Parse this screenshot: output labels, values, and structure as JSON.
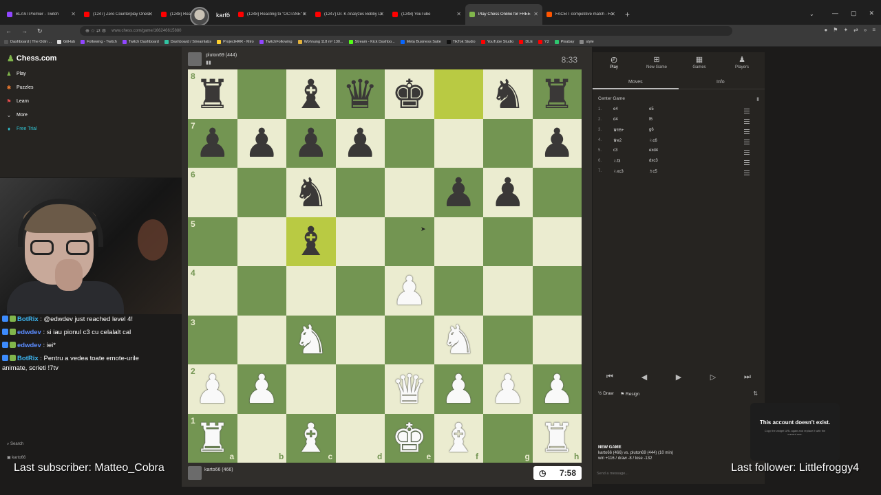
{
  "browser": {
    "tabs": [
      {
        "label": "BLASTPremier - Twitch",
        "color": "#9146ff",
        "active": false
      },
      {
        "label": "(1247) Zero Counterplay Onesi",
        "color": "#ff0000",
        "active": false
      },
      {
        "label": "(1248) React",
        "color": "#ff0000",
        "active": false
      },
      {
        "label": "(1248) Reacting to \"OCTANE\" b",
        "color": "#ff0000",
        "active": false
      },
      {
        "label": "(1247) Dr. K Analyzes Bobby Le",
        "color": "#ff0000",
        "active": false
      },
      {
        "label": "(1248) YouTube",
        "color": "#ff0000",
        "active": false
      },
      {
        "label": "Play Chess Online for FREE",
        "color": "#81b64c",
        "active": true
      },
      {
        "label": "FACEIT competitive match - FA",
        "color": "#ff5500",
        "active": false
      }
    ],
    "new_tab": "+",
    "profile_name": "karto",
    "url": "www.chess.com/game/166246615880",
    "bookmarks": [
      {
        "label": "Dashboard | The Odin ...",
        "color": "#555"
      },
      {
        "label": "GitHub",
        "color": "#ddd"
      },
      {
        "label": "Following - Twitch",
        "color": "#9146ff"
      },
      {
        "label": "Twitch Dashboard",
        "color": "#9146ff"
      },
      {
        "label": "Dashboard / Streamlabs",
        "color": "#31c3a2"
      },
      {
        "label": "ProjectHRR - Miro",
        "color": "#ffd02f"
      },
      {
        "label": "TwitchFollowing",
        "color": "#9146ff"
      },
      {
        "label": "Wohnung 118 m² 130...",
        "color": "#e3b23c"
      },
      {
        "label": "Stream - Kick Dashbo...",
        "color": "#53fc18"
      },
      {
        "label": "Meta Business Suite",
        "color": "#0866ff"
      },
      {
        "label": "TikTok Studio",
        "color": "#111"
      },
      {
        "label": "YouTube Studio",
        "color": "#ff0000"
      },
      {
        "label": "DLE",
        "color": "#ff0000"
      },
      {
        "label": "Y2",
        "color": "#ff0000"
      },
      {
        "label": "Pixabay",
        "color": "#2ec66e"
      },
      {
        "label": "style",
        "color": "#888"
      }
    ]
  },
  "sidebar": {
    "logo": "Chess.com",
    "items": [
      {
        "label": "Play",
        "icon": "♟",
        "color": "#81b64c"
      },
      {
        "label": "Puzzles",
        "icon": "✱",
        "color": "#f27c2f"
      },
      {
        "label": "Learn",
        "icon": "⚑",
        "color": "#e34c4c"
      },
      {
        "label": "More",
        "icon": "⌄",
        "color": "#bbb"
      },
      {
        "label": "Free Trial",
        "icon": "♦",
        "color": "#31c3d2"
      }
    ],
    "search": "Search",
    "user": "karto66"
  },
  "chat": [
    {
      "user": "BotRix",
      "user_color": "#3db8f5",
      "text": " : @edwdev just reached level 4!"
    },
    {
      "user": "edwdev",
      "user_color": "#5b8cff",
      "text": " : si iau pionul c3 cu celalalt cal"
    },
    {
      "user": "edwdev",
      "user_color": "#5b8cff",
      "text": " : iei*"
    },
    {
      "user": "BotRix",
      "user_color": "#3db8f5",
      "text": " : Pentru a vedea toate emote-urile"
    },
    {
      "user": "",
      "user_color": "#fff",
      "text": "animate, scrieti !7tv"
    }
  ],
  "overlay": {
    "last_subscriber": "Last subscriber: Matteo_Cobra",
    "last_follower": "Last follower: Littlefroggy4"
  },
  "game": {
    "opponent": {
      "name": "pluton69 (444)",
      "clock": "8:33"
    },
    "me": {
      "name": "karto66 (466)",
      "clock": "7:58"
    },
    "files": [
      "a",
      "b",
      "c",
      "d",
      "e",
      "f",
      "g",
      "h"
    ],
    "ranks": [
      "8",
      "7",
      "6",
      "5",
      "4",
      "3",
      "2",
      "1"
    ],
    "highlight": [
      "f8",
      "c5"
    ],
    "position": [
      [
        "br",
        "",
        "bb",
        "bq",
        "bk",
        "",
        "bn",
        "br"
      ],
      [
        "bp",
        "bp",
        "bp",
        "bp",
        "",
        "",
        "",
        "bp"
      ],
      [
        "",
        "",
        "bn",
        "",
        "",
        "bp",
        "bp",
        ""
      ],
      [
        "",
        "",
        "bb",
        "",
        "",
        "",
        "",
        ""
      ],
      [
        "",
        "",
        "",
        "",
        "wp",
        "",
        "",
        ""
      ],
      [
        "",
        "",
        "wn",
        "",
        "",
        "wn",
        "",
        ""
      ],
      [
        "wp",
        "wp",
        "",
        "",
        "wq",
        "wp",
        "wp",
        "wp"
      ],
      [
        "wr",
        "",
        "wb",
        "",
        "wk",
        "wb",
        "",
        "wr"
      ]
    ]
  },
  "panel": {
    "tabs": [
      {
        "label": "Play",
        "icon": "◴"
      },
      {
        "label": "New Game",
        "icon": "⊞"
      },
      {
        "label": "Games",
        "icon": "▦"
      },
      {
        "label": "Players",
        "icon": "♟"
      }
    ],
    "subtabs": [
      "Moves",
      "Info"
    ],
    "opening": "Center Game",
    "moves": [
      {
        "n": "1.",
        "w": "e4",
        "b": "e5"
      },
      {
        "n": "2.",
        "w": "d4",
        "b": "f6"
      },
      {
        "n": "3.",
        "w": "♛h5+",
        "b": "g6"
      },
      {
        "n": "4.",
        "w": "♛e2",
        "b": "♘c6"
      },
      {
        "n": "5.",
        "w": "c3",
        "b": "exd4"
      },
      {
        "n": "6.",
        "w": "♘f3",
        "b": "dxc3"
      },
      {
        "n": "7.",
        "w": "♘xc3",
        "b": "♗c5"
      }
    ],
    "controls": [
      "⏮",
      "◀",
      "▶",
      "▷",
      "⏭"
    ],
    "draw": "Draw",
    "resign": "Resign",
    "newgame_title": "NEW GAME",
    "newgame_line1": "karto66 (466) vs. pluton69 (444) (10 min)",
    "newgame_line2": "win +116 / draw -8 / lose -132",
    "send_placeholder": "Send a message..."
  },
  "toast": {
    "title": "This account doesn't exist.",
    "desc": "Copy the widget URL again and replace it with the current one."
  }
}
